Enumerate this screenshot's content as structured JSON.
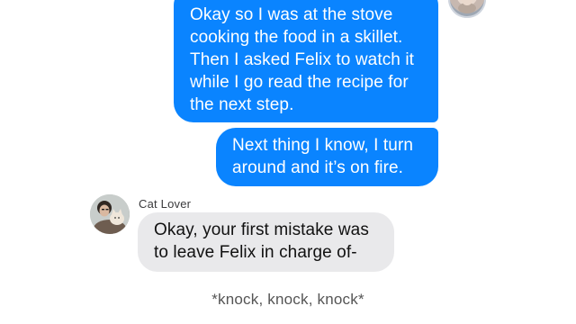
{
  "conversation": {
    "messages": [
      {
        "sender": "me",
        "text": "Okay so I was at the stove\ncooking the food in a skillet.\nThen I asked Felix to watch it\nwhile I go read the recipe for\nthe next step."
      },
      {
        "sender": "me",
        "text": "Next thing I know, I turn\naround and it’s on fire."
      },
      {
        "sender": "Cat Lover",
        "text": "Okay, your first mistake was\nto leave Felix in charge of-"
      }
    ],
    "contact_name": "Cat Lover"
  },
  "caption": "*knock, knock, knock*",
  "colors": {
    "outgoing_bubble": "#0a84ff",
    "incoming_bubble": "#e9e9eb"
  },
  "icons": {
    "my_avatar": "user-avatar",
    "contact_avatar": "cat-lover-avatar"
  }
}
